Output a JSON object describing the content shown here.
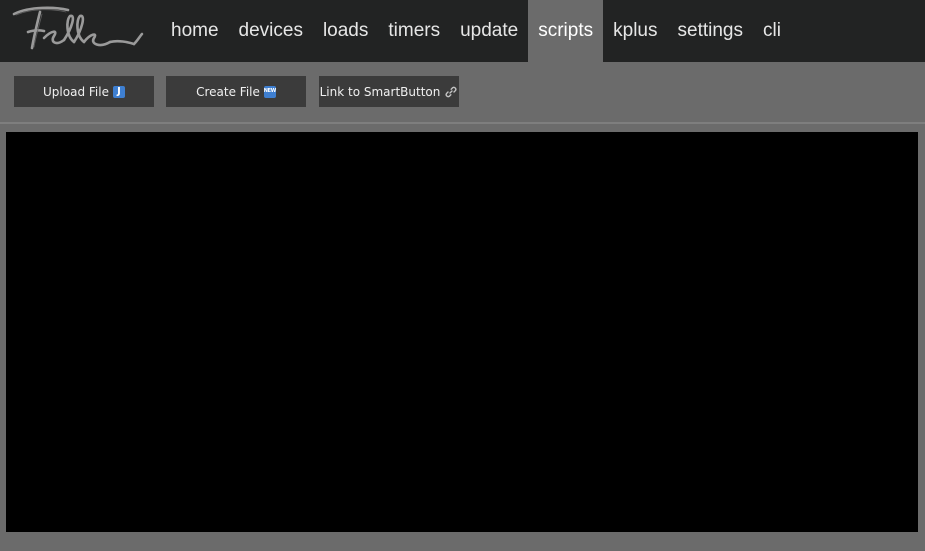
{
  "brand": {
    "logo_icon": "feller-logo"
  },
  "nav": {
    "active": "scripts",
    "items": [
      {
        "id": "home",
        "label": "home"
      },
      {
        "id": "devices",
        "label": "devices"
      },
      {
        "id": "loads",
        "label": "loads"
      },
      {
        "id": "timers",
        "label": "timers"
      },
      {
        "id": "update",
        "label": "update"
      },
      {
        "id": "scripts",
        "label": "scripts"
      },
      {
        "id": "kplus",
        "label": "kplus"
      },
      {
        "id": "settings",
        "label": "settings"
      },
      {
        "id": "cli",
        "label": "cli"
      }
    ]
  },
  "toolbar": {
    "upload_label": "Upload File",
    "upload_icon": "j-badge-icon",
    "create_label": "Create File",
    "create_icon": "new-badge-icon",
    "create_badge_text": "NEW",
    "link_label": "Link to SmartButton",
    "link_icon": "link-icon"
  },
  "colors": {
    "topbar": "#222323",
    "background": "#6b6b6b",
    "button": "#3b3b3b",
    "editor": "#000000",
    "accent": "#3e7fd1"
  }
}
